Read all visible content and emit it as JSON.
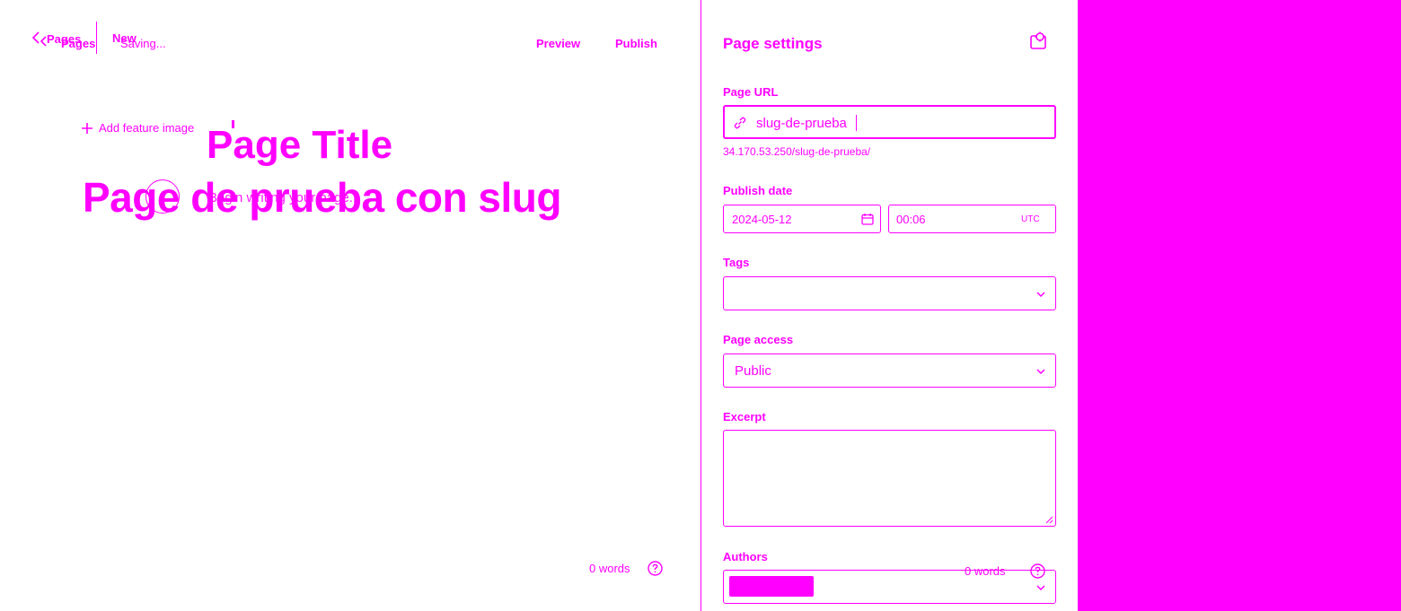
{
  "header": {
    "back_label": "Pages",
    "breadcrumb_pages": "Pages",
    "status_new": "New",
    "status_saving": "Saving...",
    "preview_label": "Preview",
    "publish_label": "Publish"
  },
  "editor": {
    "add_feature_image": "Add feature image",
    "placeholder_title": "Page Title",
    "title": "Page de prueba con slug",
    "body_placeholder": "Begin writing your page...",
    "word_count": "0 words"
  },
  "sidebar": {
    "title": "Page settings",
    "page_url": {
      "label": "Page URL",
      "value": "slug-de-prueba",
      "full_url": "34.170.53.250/slug-de-prueba/"
    },
    "publish_date": {
      "label": "Publish date",
      "date": "2024-05-12",
      "time": "00:06",
      "timezone": "UTC"
    },
    "tags": {
      "label": "Tags",
      "value": ""
    },
    "page_access": {
      "label": "Page access",
      "value": "Public"
    },
    "excerpt": {
      "label": "Excerpt",
      "value": ""
    },
    "authors": {
      "label": "Authors"
    },
    "word_count": "0 words"
  },
  "colors": {
    "accent": "#ff00ff",
    "background": "#ffffff"
  }
}
